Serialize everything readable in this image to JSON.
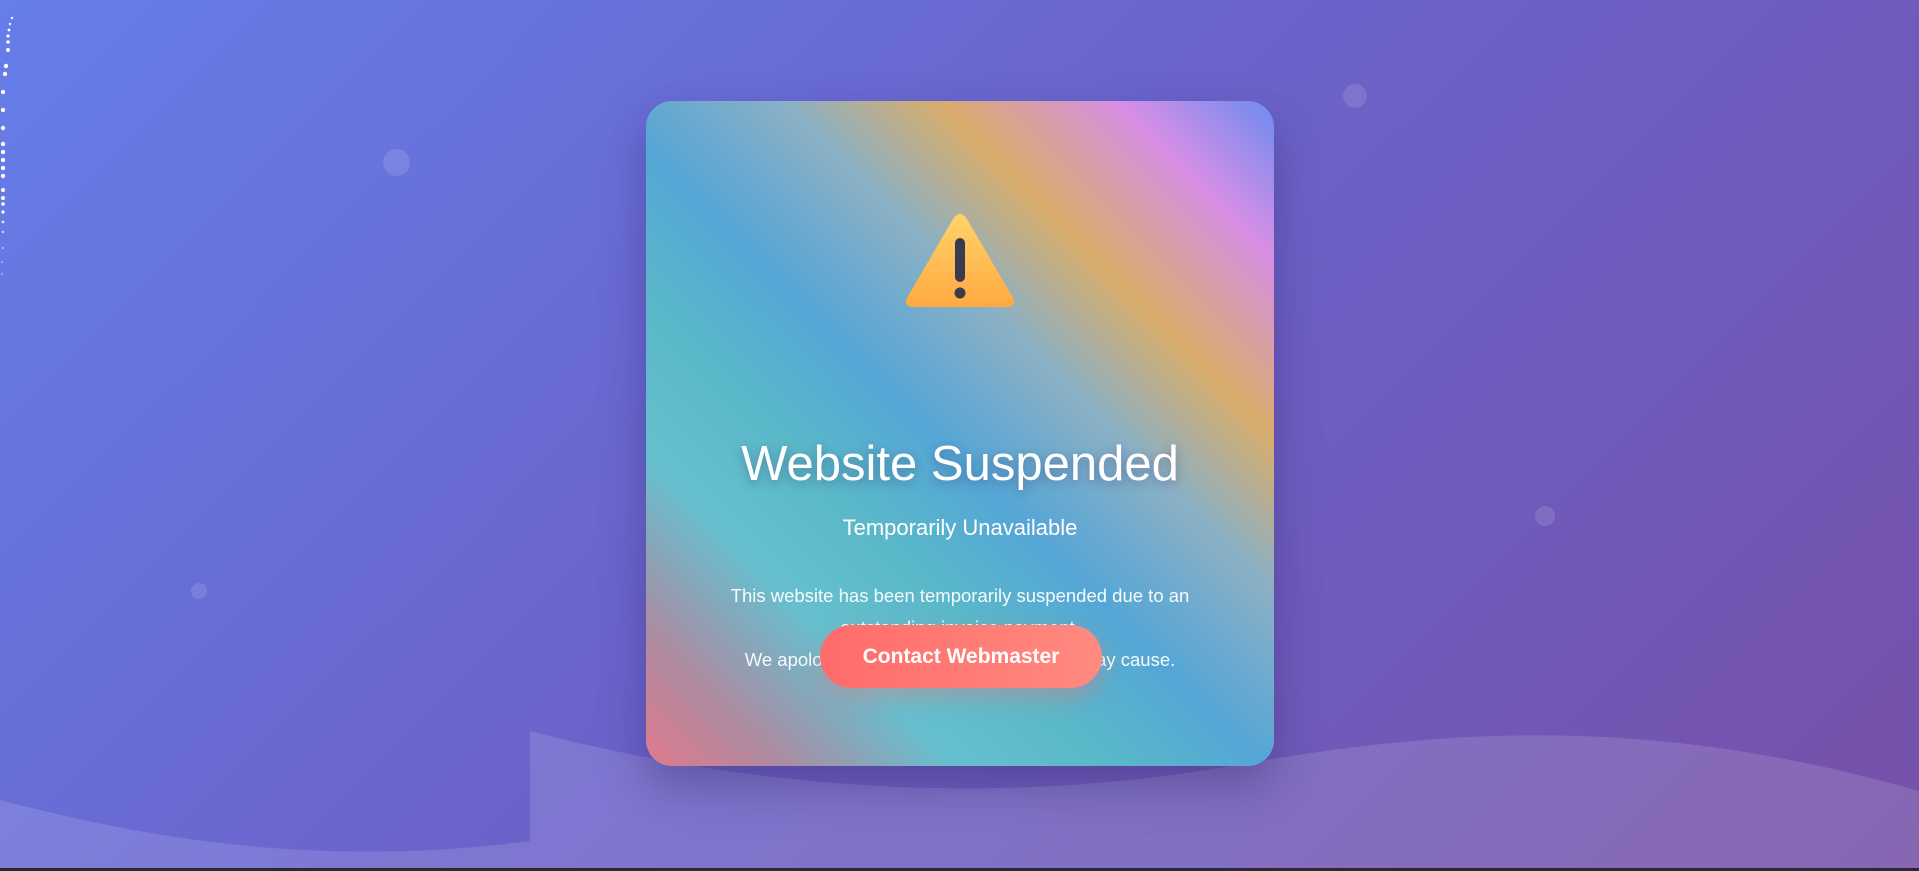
{
  "notice": {
    "title": "Website Suspended",
    "subtitle": "Temporarily Unavailable",
    "message_line_1": "This website has been temporarily suspended due to an outstanding invoice payment.",
    "message_line_2": "We apologize for any inconvenience this may cause.",
    "icon": "warning-triangle-icon",
    "button_label": "Contact Webmaster"
  },
  "colors": {
    "background_start": "#667eea",
    "background_end": "#764ba2",
    "button_start": "#ff6b6b",
    "button_end": "#ff8a80",
    "icon_fill": "#ffb347",
    "icon_mark": "#3b3b4f"
  }
}
